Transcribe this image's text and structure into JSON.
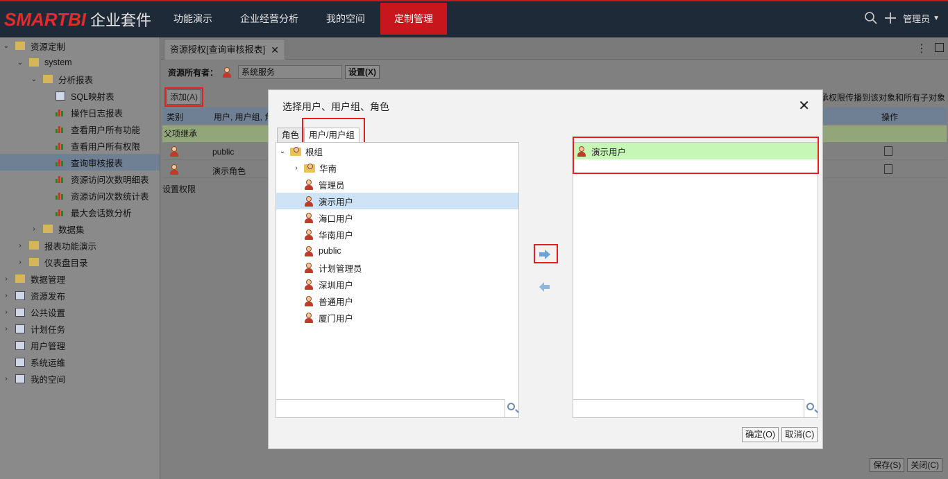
{
  "brand": {
    "logo": "SMARTBI",
    "suite": "企业套件",
    "accent": "#c8161d"
  },
  "nav": [
    {
      "label": "功能演示"
    },
    {
      "label": "企业经营分析"
    },
    {
      "label": "我的空间"
    },
    {
      "label": "定制管理"
    }
  ],
  "user": {
    "name": "管理员"
  },
  "sidebar": {
    "items": [
      {
        "label": "资源定制"
      },
      {
        "label": "system"
      },
      {
        "label": "分析报表"
      },
      {
        "label": "SQL映射表"
      },
      {
        "label": "操作日志报表"
      },
      {
        "label": "查看用户所有功能"
      },
      {
        "label": "查看用户所有权限"
      },
      {
        "label": "查询审核报表"
      },
      {
        "label": "资源访问次数明细表"
      },
      {
        "label": "资源访问次数统计表"
      },
      {
        "label": "最大会话数分析"
      },
      {
        "label": "数据集"
      },
      {
        "label": "报表功能演示"
      },
      {
        "label": "仪表盘目录"
      },
      {
        "label": "数据管理"
      },
      {
        "label": "资源发布"
      },
      {
        "label": "公共设置"
      },
      {
        "label": "计划任务"
      },
      {
        "label": "用户管理"
      },
      {
        "label": "系统运维"
      },
      {
        "label": "我的空间"
      }
    ]
  },
  "main": {
    "tab_label": "资源授权[查询审核报表]",
    "owner_label": "资源所有者：",
    "owner_value": "系统服务",
    "owner_set_btn": "设置(X)",
    "add_btn": "添加(A)",
    "hint": "承权限传播到该对象和所有子对象",
    "col_type": "类别",
    "col_user": "用户, 用户组, 角",
    "col_op": "操作",
    "parent_row": "父项继承",
    "rows": [
      {
        "name": "public"
      },
      {
        "name": "演示角色"
      }
    ],
    "set_perm": "设置权限",
    "save_btn": "保存(S)",
    "close_btn": "关闭(C)"
  },
  "dialog": {
    "title": "选择用户、用户组、角色",
    "tabs": [
      {
        "label": "角色"
      },
      {
        "label": "用户/用户组"
      }
    ],
    "tree": [
      {
        "label": "根组"
      },
      {
        "label": "华南"
      },
      {
        "label": "管理员"
      },
      {
        "label": "演示用户"
      },
      {
        "label": "海口用户"
      },
      {
        "label": "华南用户"
      },
      {
        "label": "public"
      },
      {
        "label": "计划管理员"
      },
      {
        "label": "深圳用户"
      },
      {
        "label": "普通用户"
      },
      {
        "label": "厦门用户"
      }
    ],
    "selected": [
      {
        "label": "演示用户"
      }
    ],
    "left_search_placeholder": "",
    "right_search_placeholder": "",
    "ok_btn": "确定(O)",
    "cancel_btn": "取消(C)"
  }
}
